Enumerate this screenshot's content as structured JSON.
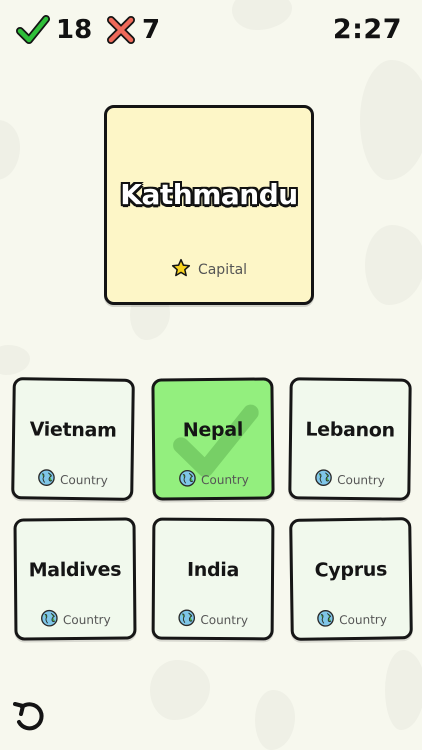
{
  "header": {
    "correct_count": "18",
    "wrong_count": "7",
    "timer": "2:27",
    "correct_icon": "check-icon",
    "wrong_icon": "cross-icon"
  },
  "question": {
    "title": "Kathmandu",
    "type_label": "Capital",
    "type_icon": "star-icon",
    "background": "#fdf6c7"
  },
  "answers": [
    {
      "name": "Vietnam",
      "type_label": "Country",
      "icon": "globe-icon",
      "selected": false
    },
    {
      "name": "Nepal",
      "type_label": "Country",
      "icon": "globe-icon",
      "selected": true
    },
    {
      "name": "Lebanon",
      "type_label": "Country",
      "icon": "globe-icon",
      "selected": false
    },
    {
      "name": "Maldives",
      "type_label": "Country",
      "icon": "globe-icon",
      "selected": false
    },
    {
      "name": "India",
      "type_label": "Country",
      "icon": "globe-icon",
      "selected": false
    },
    {
      "name": "Cyprus",
      "type_label": "Country",
      "icon": "globe-icon",
      "selected": false
    }
  ],
  "colors": {
    "correct": "#2fbf3a",
    "wrong": "#ef6a5a",
    "selected_card": "#93ef7e",
    "card": "#f1f9ed"
  },
  "footer": {
    "undo_icon": "undo-icon"
  }
}
